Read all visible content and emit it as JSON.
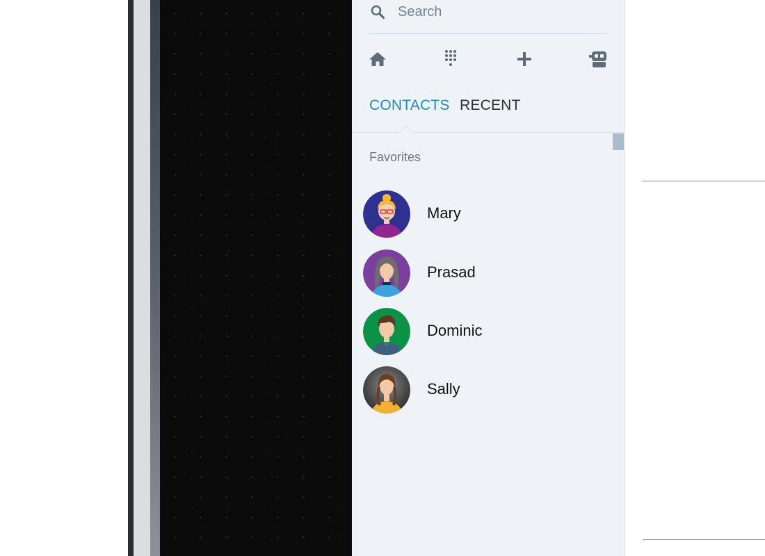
{
  "search": {
    "placeholder": "Search"
  },
  "toolbar": {
    "icons": [
      "home-icon",
      "dialpad-icon",
      "add-icon",
      "bot-icon"
    ]
  },
  "tabs": [
    {
      "label": "CONTACTS",
      "active": true
    },
    {
      "label": "RECENT",
      "active": false
    }
  ],
  "favorites": {
    "label": "Favorites",
    "contacts": [
      {
        "name": "Mary"
      },
      {
        "name": "Prasad"
      },
      {
        "name": "Dominic"
      },
      {
        "name": "Sally"
      }
    ]
  },
  "colors": {
    "accent": "#1a8ec7",
    "panel_bg": "#eff3f8",
    "icon_gray": "#5f6b78"
  }
}
